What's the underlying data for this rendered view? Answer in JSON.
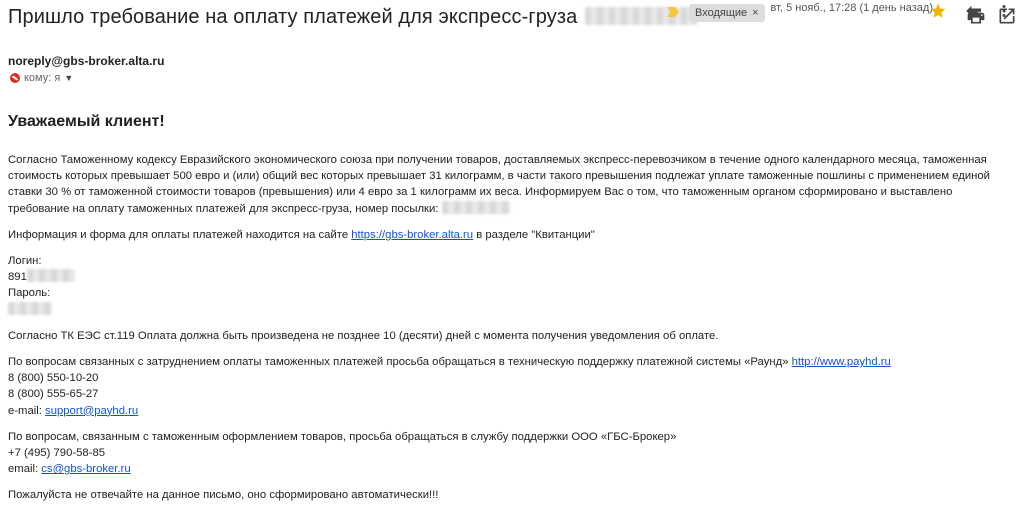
{
  "header": {
    "subject": "Пришло требование на оплату платежей для экспресс-груза",
    "label": "Входящие",
    "label_close": "×",
    "icons": [
      "print-icon",
      "open-in-new-window-icon"
    ]
  },
  "sender": {
    "email": "noreply@gbs-broker.alta.ru",
    "to_line": "кому: я",
    "date": "вт, 5 нояб., 17:28 (1 день назад)",
    "icons": [
      "star-icon",
      "reply-icon",
      "more-vert-icon"
    ]
  },
  "body": {
    "greeting": "Уважаемый клиент!",
    "paragraph1": "Согласно Таможенному кодексу Евразийского экономического союза при получении товаров, доставляемых экспресс-перевозчиком в течение одного календарного месяца, таможенная стоимость которых превышает 500 евро и (или) общий вес которых превышает 31 килограмм, в части такого превышения подлежат уплате таможенные пошлины с применением единой ставки 30 % от таможенной стоимости товаров (превышения) или 4 евро за 1 килограмм их веса. Информируем Вас о том, что таможенным органом сформировано и выставлено требование на оплату таможенных платежей для экспресс-груза, номер посылки:",
    "paragraph2_before": "Информация и форма для оплаты платежей находится на сайте",
    "site_link": "https://gbs-broker.alta.ru",
    "paragraph2_after": "в разделе \"Квитанции\"",
    "login_label": "Логин:",
    "login_value_prefix": "891",
    "password_label": "Пароль:",
    "deadline": "Согласно ТК ЕЭС ст.119 Оплата должна быть произведена не позднее 10 (десяти) дней с момента получения уведомления об оплате.",
    "payhd_text": "По вопросам связанных с затруднением оплаты таможенных платежей просьба обращаться в техническую поддержку платежной системы «Раунд»",
    "payhd_link": "http://www.payhd.ru",
    "phone1": "8 (800) 550-10-20",
    "phone2": "8 (800) 555-65-27",
    "email1_label": "e-mail:",
    "email1_link": "support@payhd.ru",
    "gbs_text": "По вопросам, связанным с таможенным оформлением товаров, просьба обращаться в службу поддержки ООО «ГБС-Брокер»",
    "phone3": "+7 (495) 790-58-85",
    "email2_label": "email:",
    "email2_link": "cs@gbs-broker.ru",
    "closing": "Пожалуйста не отвечайте на данное письмо, оно сформировано автоматически!!!"
  },
  "colors": {
    "link": "#1155cc",
    "important_marker": "#f2c744",
    "star": "#f4b400",
    "label_chip_bg": "#dddddd"
  }
}
